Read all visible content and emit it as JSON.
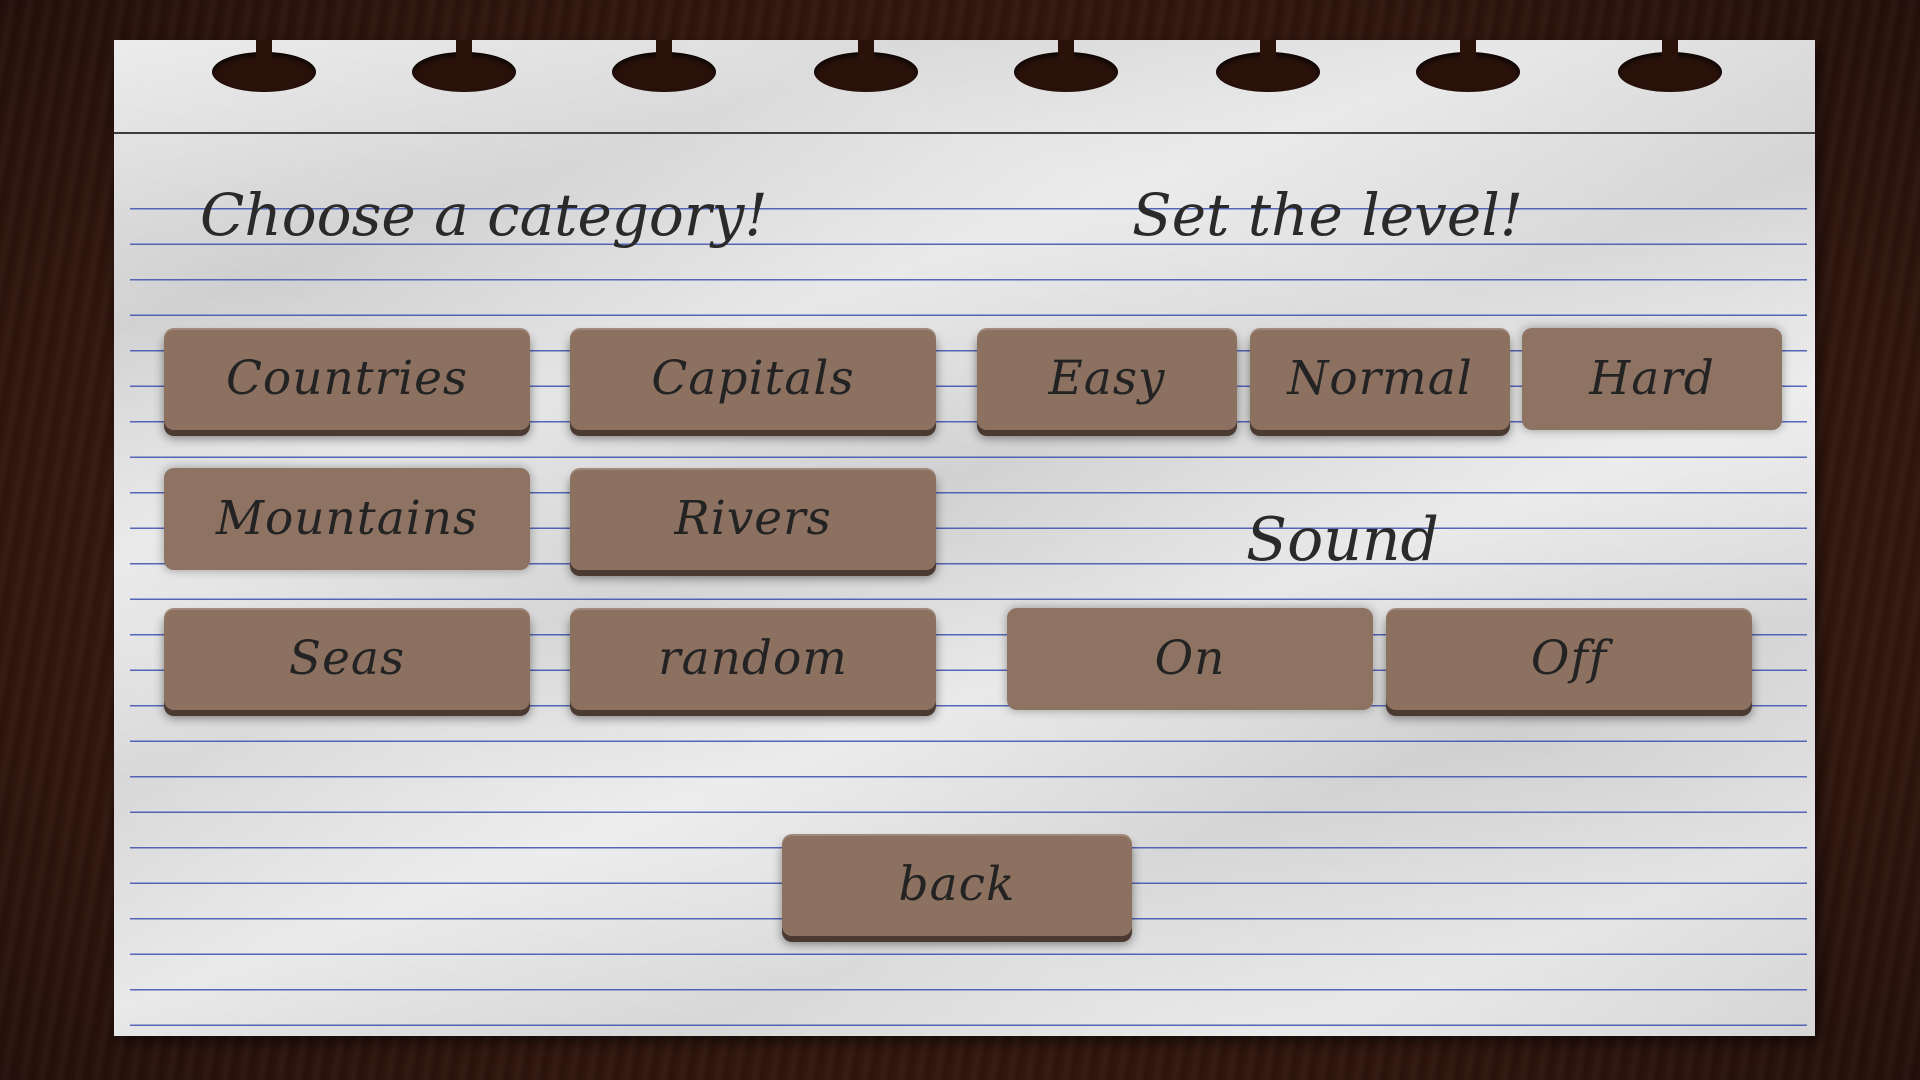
{
  "headings": {
    "category": "Choose a category!",
    "level": "Set the level!",
    "sound": "Sound"
  },
  "categories": [
    {
      "label": "Countries"
    },
    {
      "label": "Capitals"
    },
    {
      "label": "Mountains"
    },
    {
      "label": "Rivers"
    },
    {
      "label": "Seas"
    },
    {
      "label": "random"
    }
  ],
  "levels": [
    {
      "label": "Easy"
    },
    {
      "label": "Normal"
    },
    {
      "label": "Hard"
    }
  ],
  "sound_options": [
    {
      "label": "On"
    },
    {
      "label": "Off"
    }
  ],
  "selected": {
    "category": "Mountains",
    "level": "Hard",
    "sound": "On"
  },
  "back_label": "back",
  "colors": {
    "button": "#8c7060",
    "button_shadow": "#4a3a32",
    "paper": "#dcdcdc",
    "rule_line": "#3b4fb0",
    "wood": "#35180f",
    "text": "#232323"
  }
}
